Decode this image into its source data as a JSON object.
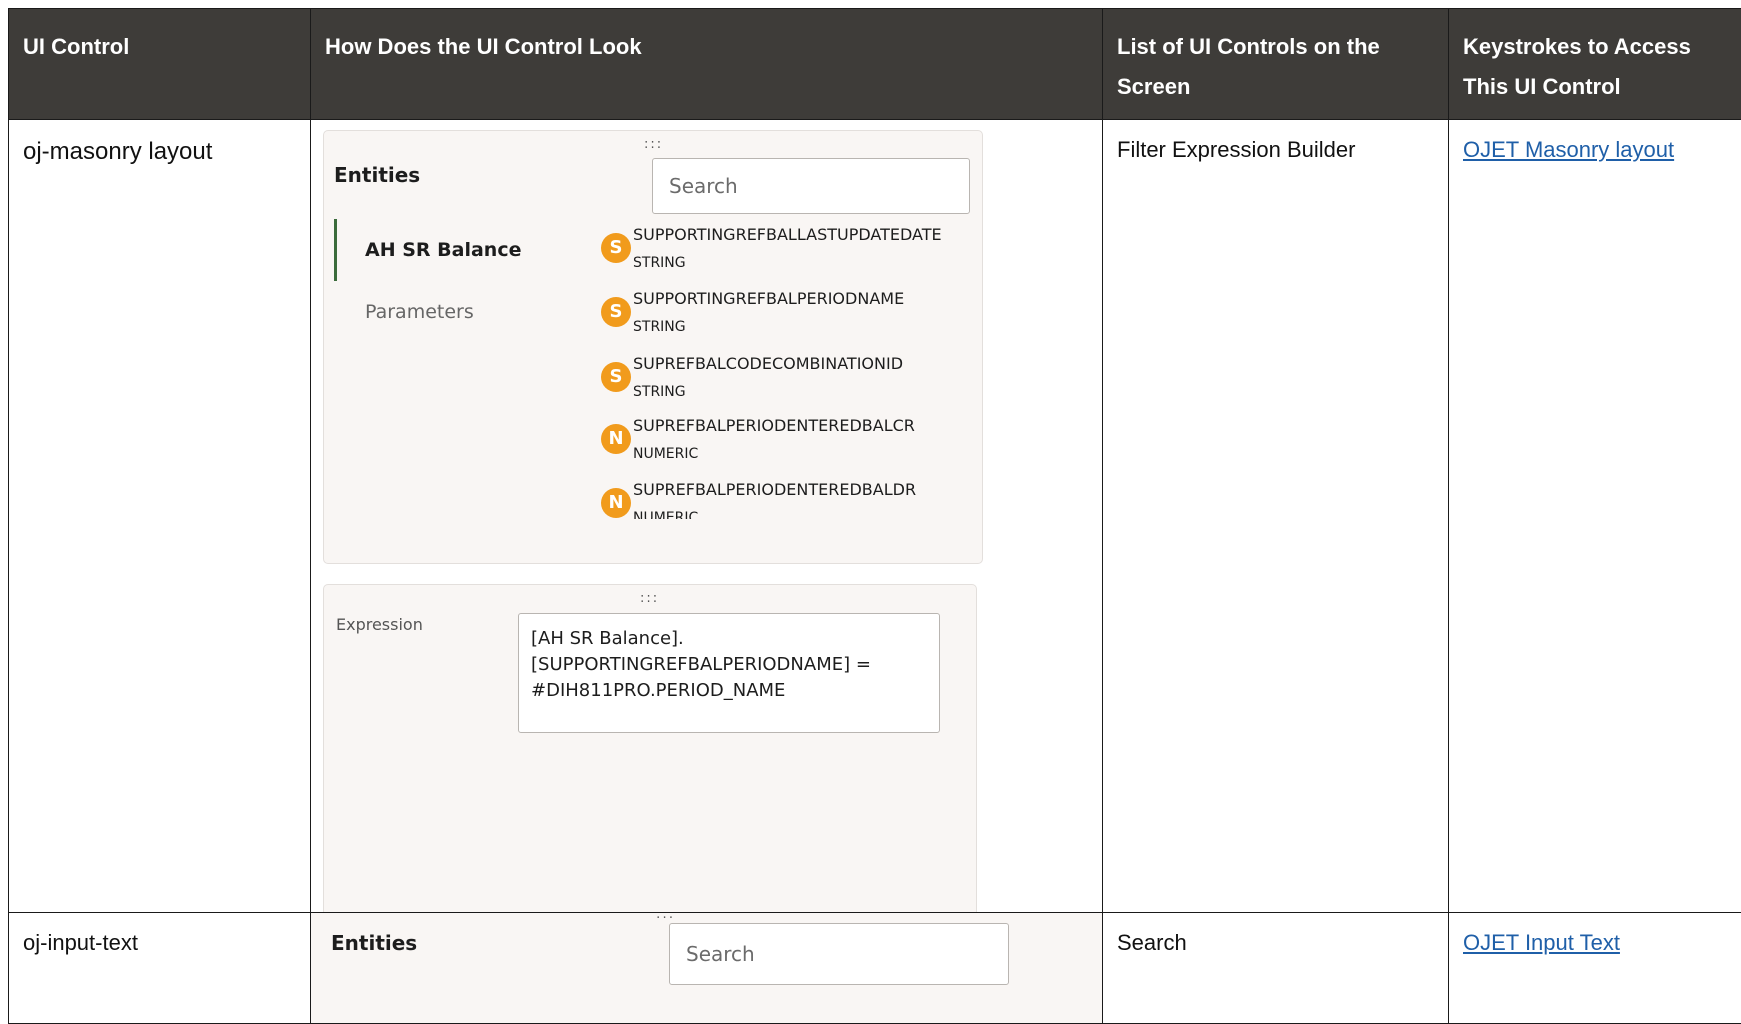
{
  "table": {
    "headers": [
      "UI Control",
      "How Does the UI Control Look",
      "List of UI Controls on the Screen",
      "Keystrokes to Access This UI Control"
    ],
    "rows": [
      {
        "control": "oj-masonry layout",
        "controls_list": "Filter Expression Builder",
        "link": "OJET Masonry layout"
      },
      {
        "control": "oj-input-text",
        "controls_list": "Search",
        "link": "OJET Input Text"
      }
    ]
  },
  "shot1": {
    "grip": ":::",
    "entities_title": "Entities",
    "search_placeholder": "Search",
    "nav": [
      "AH SR Balance",
      "Parameters"
    ],
    "fields": [
      {
        "badge": "S",
        "name": "SUPPORTINGREFBALLASTUPDATEDATE",
        "type": "STRING"
      },
      {
        "badge": "S",
        "name": "SUPPORTINGREFBALPERIODNAME",
        "type": "STRING"
      },
      {
        "badge": "S",
        "name": "SUPREFBALCODECOMBINATIONID",
        "type": "STRING"
      },
      {
        "badge": "N",
        "name": "SUPREFBALPERIODENTEREDBALCR",
        "type": "NUMERIC"
      },
      {
        "badge": "N",
        "name": "SUPREFBALPERIODENTEREDBALDR",
        "type": "NUMERIC"
      }
    ],
    "expression_label": "Expression",
    "expression_lines": [
      "[AH SR Balance].",
      "[SUPPORTINGREFBALPERIODNAME] =",
      "#DIH811PRO.PERIOD_NAME"
    ]
  },
  "shot2": {
    "grip": ":::",
    "entities_title": "Entities",
    "search_placeholder": "Search"
  },
  "colors": {
    "header_bg": "#3e3c39",
    "badge": "#f19b1c",
    "link": "#1f5fa8",
    "card_bg": "#f9f6f4"
  }
}
